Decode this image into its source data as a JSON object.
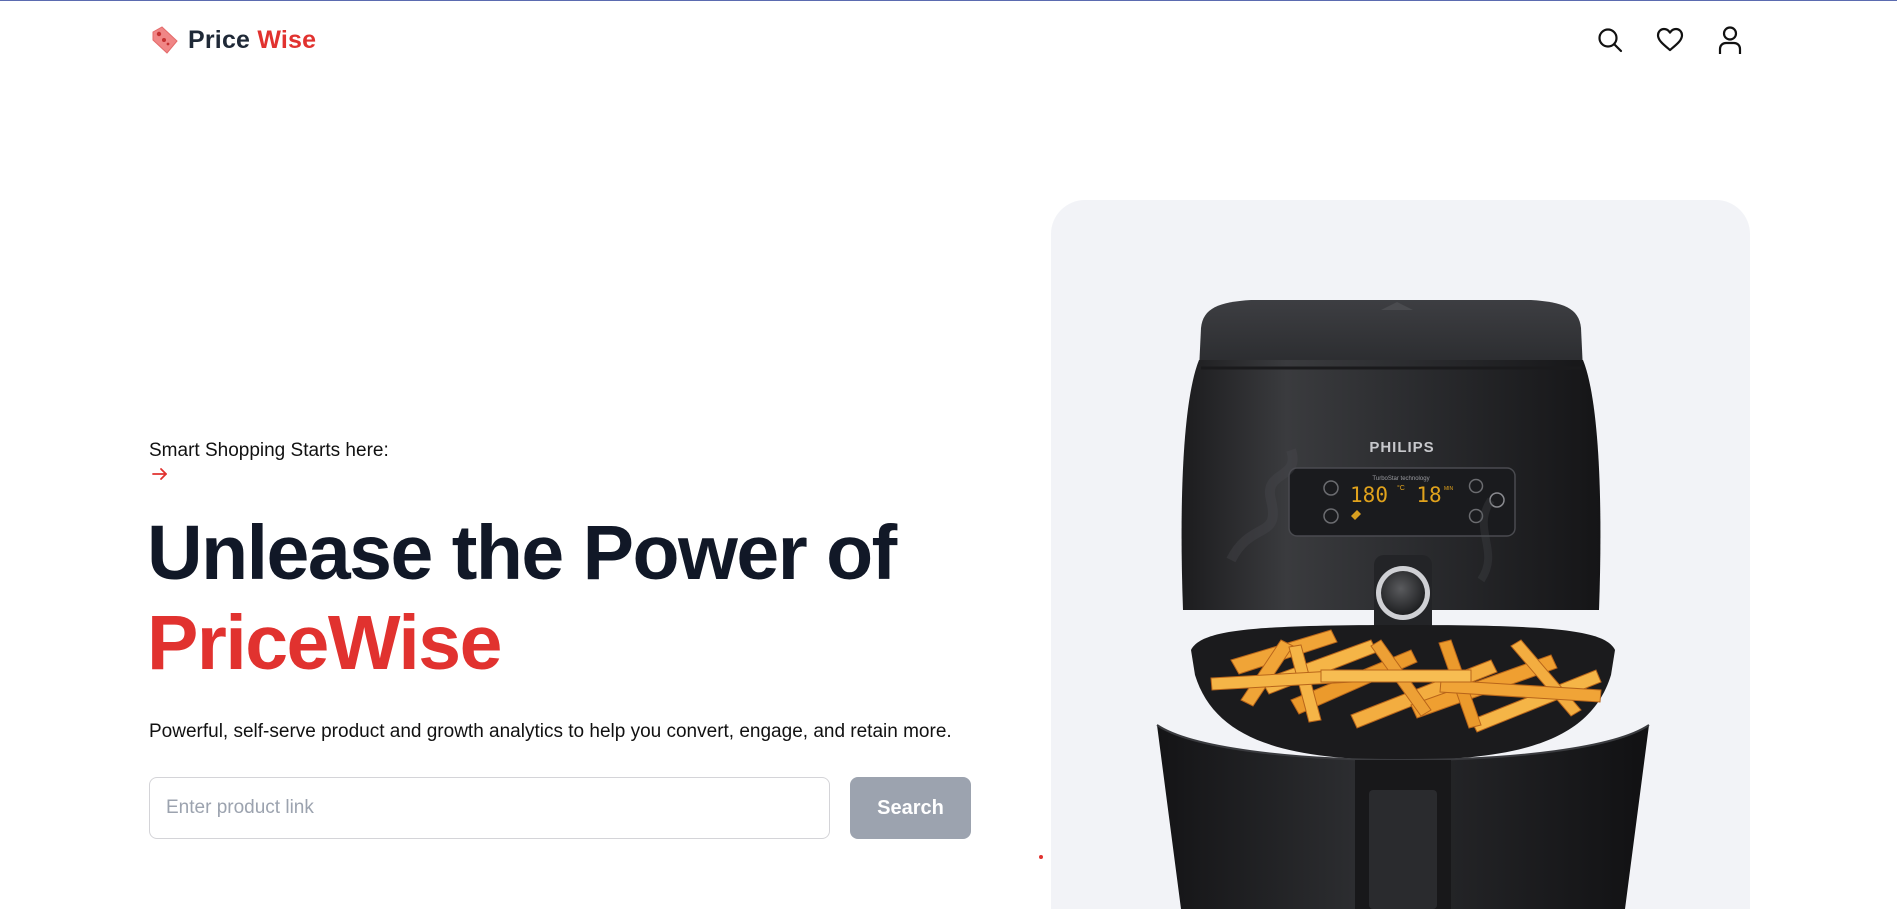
{
  "header": {
    "logo": {
      "word1": "Price",
      "word2": "Wise",
      "icon": "price-tag-icon"
    },
    "nav_icons": [
      "search-icon",
      "heart-icon",
      "user-icon"
    ]
  },
  "hero": {
    "tagline": "Smart Shopping Starts here:",
    "arrow_icon": "arrow-right-icon",
    "headline_line1": "Unlease the Power of",
    "headline_brand": "PriceWise",
    "subtext": "Powerful, self-serve product and growth analytics to help you convert, engage, and retain more.",
    "search": {
      "placeholder": "Enter product link",
      "value": "",
      "button_label": "Search"
    }
  },
  "product": {
    "brand_label": "PHILIPS",
    "display_line": "TurboStar technology",
    "temperature": "180",
    "temp_unit": "°C",
    "time": "18",
    "time_unit": "MIN"
  },
  "colors": {
    "accent": "#e1322f",
    "text_dark": "#111827",
    "button_disabled": "#9ca3af",
    "card_bg": "#f2f3f7"
  }
}
